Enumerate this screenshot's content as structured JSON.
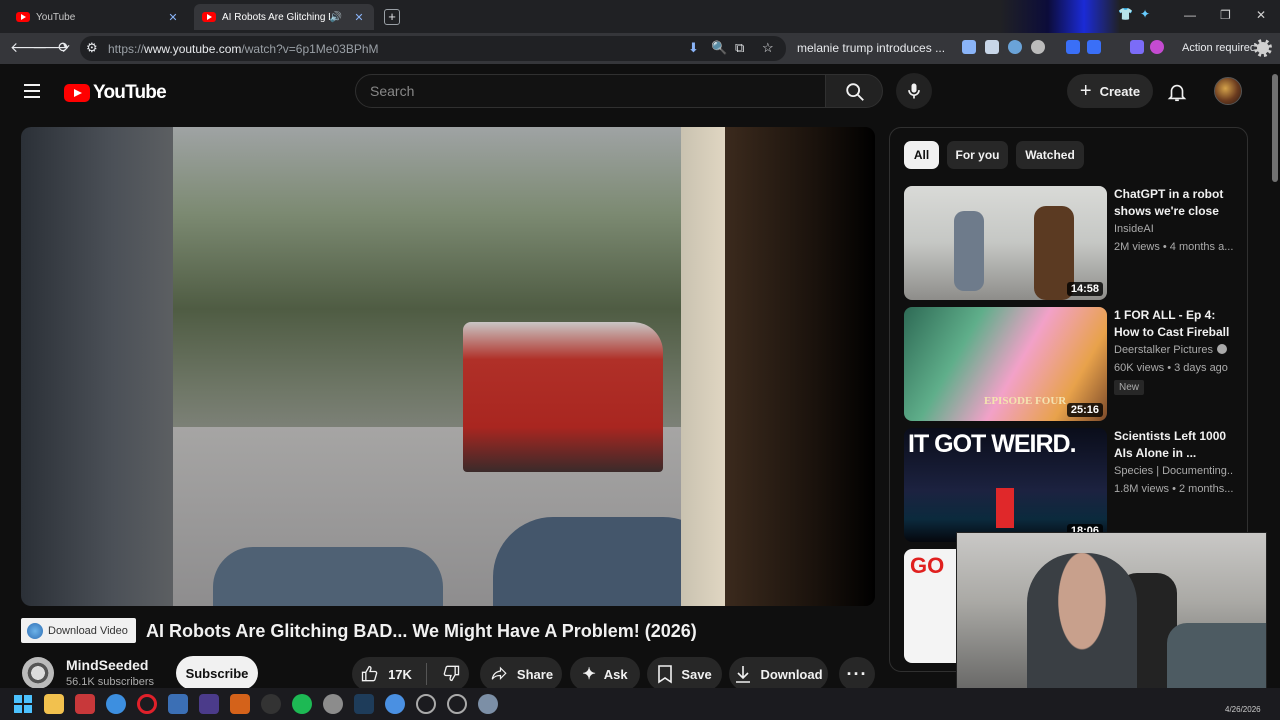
{
  "browser": {
    "tabs": [
      {
        "title": "YouTube"
      },
      {
        "title": "AI Robots Are Glitching BAD..."
      }
    ],
    "new_tab": "+",
    "url": {
      "scheme": "https://",
      "host": "www.youtube.com",
      "path": "/watch?v=6p1Me03BPhM"
    },
    "search_suggestion": "melanie trump introduces ...",
    "action_required": "Action required"
  },
  "yt": {
    "logo_text": "YouTube",
    "search_placeholder": "Search",
    "create_label": "Create"
  },
  "video": {
    "download_video_label": "Download Video",
    "title": "AI Robots Are Glitching BAD... We Might Have A Problem! (2026)",
    "channel": "MindSeeded",
    "subscribers": "56.1K subscribers",
    "subscribe_label": "Subscribe",
    "likes": "17K",
    "share_label": "Share",
    "ask_label": "Ask",
    "save_label": "Save",
    "download_label": "Download"
  },
  "chips": [
    "All",
    "For you",
    "Watched"
  ],
  "recommendations": [
    {
      "title": "ChatGPT in a robot shows we're close ...",
      "channel": "InsideAI",
      "meta": "2M views • 4 months a...",
      "duration": "14:58",
      "verified": false,
      "badge": ""
    },
    {
      "title": "1 FOR ALL - Ep 4: How to Cast Fireball",
      "channel": "Deerstalker Pictures",
      "meta": "60K views • 3 days ago",
      "duration": "25:16",
      "verified": true,
      "badge": "New"
    },
    {
      "title": "Scientists Left 1000 AIs Alone in ...",
      "channel": "Species | Documenting...",
      "meta": "1.8M views • 2 months...",
      "duration": "18:06",
      "verified": false,
      "badge": ""
    },
    {
      "title": "",
      "channel": "",
      "meta": "",
      "duration": "",
      "verified": false,
      "badge": ""
    }
  ],
  "thumbs": {
    "rec1_caption": "",
    "rec2_caption": "EPISODE FOUR",
    "rec3_caption": "IT GOT WEIRD.",
    "rec4_caption": "GO"
  },
  "taskbar": {
    "date": "4/26/2026"
  },
  "colors": {
    "yt_red": "#ff0000",
    "bg": "#0f0f0f",
    "pill": "#272727"
  }
}
